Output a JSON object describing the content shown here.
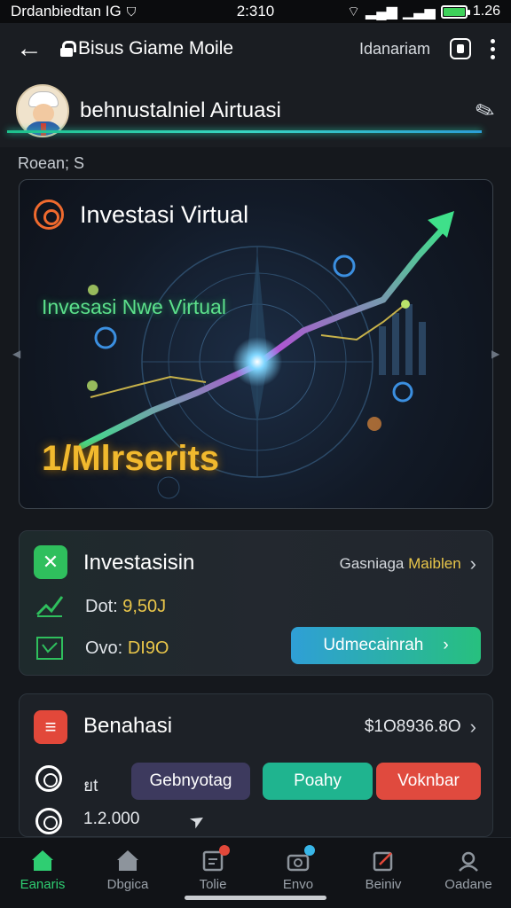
{
  "status_bar": {
    "left_text": "Drdanbiedtan IG",
    "time": "2:310",
    "right_text": "1.26",
    "battery_color": "#3ed15a"
  },
  "app_bar": {
    "title": "Bisus Giame Moile",
    "link": "Idanariam",
    "icons": [
      "back-arrow-icon",
      "lock-icon",
      "square-button-icon",
      "more-vert-icon"
    ]
  },
  "profile": {
    "name": "behnustalniel Airtuasi",
    "subtitle": "Roean; S"
  },
  "hero": {
    "title": "Investasi Virtual",
    "caption": "Invesasi Nwe Virtual",
    "big_text": "1/Mlrserits",
    "accent_green": "#3fe08a",
    "accent_gold": "#f1b92e"
  },
  "invest_card": {
    "title": "Investasisin",
    "link_prefix": "Gasniaga",
    "link_highlight": "Maiblen",
    "row1_label": "Dot:",
    "row1_value": "9,50J",
    "row2_label": "Ovo:",
    "row2_value": "DI9O",
    "button": "Udmecainrah"
  },
  "benahasi_card": {
    "title": "Benahasi",
    "price": "$1O8936.8O",
    "row1_label": "ยt",
    "pill1": "Gebnyotag",
    "pill2": "Poahy",
    "pill3": "Voknbar",
    "row2_value": "1.2.000"
  },
  "bottom_nav": [
    {
      "label": "Eanaris",
      "active": true
    },
    {
      "label": "Dbgica",
      "active": false
    },
    {
      "label": "Tolie",
      "active": false
    },
    {
      "label": "Envo",
      "active": false
    },
    {
      "label": "Beiniv",
      "active": false
    },
    {
      "label": "Oadane",
      "active": false
    }
  ]
}
